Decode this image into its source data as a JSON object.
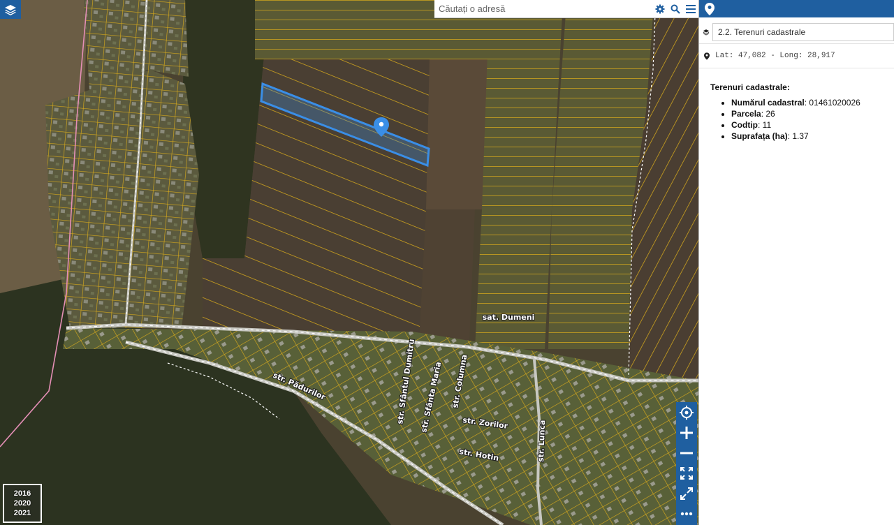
{
  "search": {
    "placeholder": "Căutați o adresă"
  },
  "icons": {
    "layers": "layers-icon",
    "settings": "gear-icon",
    "search": "search-icon",
    "menu": "menu-icon",
    "location": "map-pin-icon",
    "locate": "locate-icon",
    "zoom_in": "plus-icon",
    "zoom_out": "minus-icon",
    "fit": "fit-bounds-icon",
    "fullscreen": "fullscreen-icon",
    "more": "more-icon"
  },
  "colors": {
    "accent": "#1f5fa0",
    "parcel_lines": "#d6a91c",
    "selection": "#3a8ee6"
  },
  "map": {
    "village_label": "sat. Dumeni",
    "streets": [
      "str. Pădurilor",
      "str. Sfântul Dumitru",
      "str. Sfânta Maria",
      "str. Columna",
      "str. Zorilor",
      "str. Hotin",
      "str. Lunca"
    ],
    "years": [
      "2016",
      "2020",
      "2021"
    ]
  },
  "panel": {
    "layer": "2.2. Terenuri cadastrale",
    "coordinates": "Lat: 47,082 - Long: 28,917",
    "info_title": "Terenuri cadastrale:",
    "attributes": [
      {
        "label": "Numărul cadastral",
        "value": "01461020026"
      },
      {
        "label": "Parcela",
        "value": "26"
      },
      {
        "label": "Codtip",
        "value": "11"
      },
      {
        "label": "Suprafața (ha)",
        "value": "1.37"
      }
    ]
  }
}
